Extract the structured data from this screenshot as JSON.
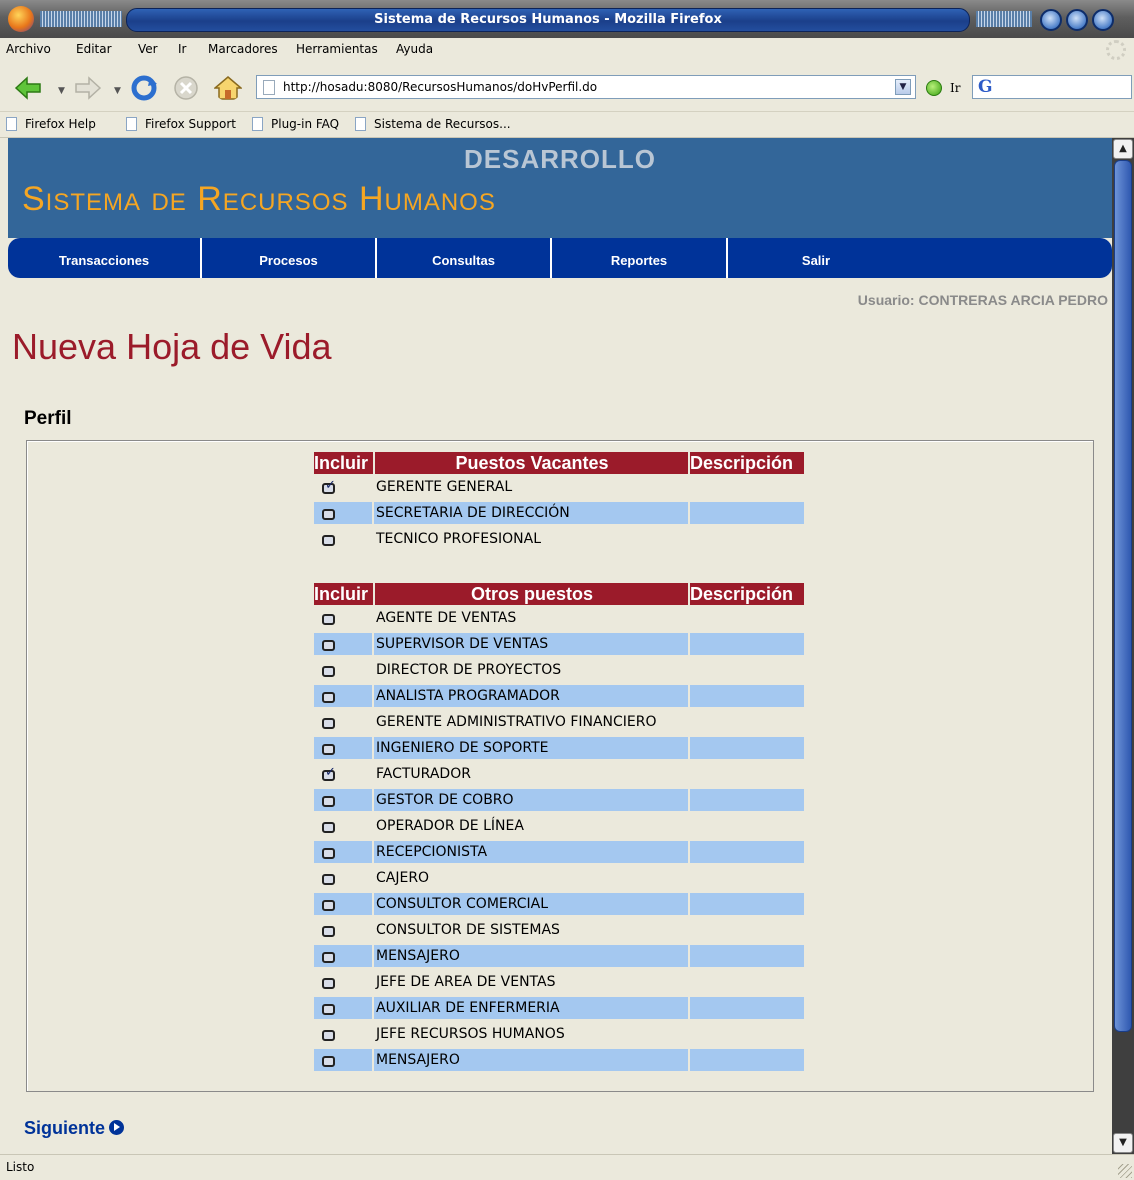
{
  "window": {
    "title": "Sistema de Recursos Humanos - Mozilla Firefox"
  },
  "menubar": [
    "Archivo",
    "Editar",
    "Ver",
    "Ir",
    "Marcadores",
    "Herramientas",
    "Ayuda"
  ],
  "navbar": {
    "url": "http://hosadu:8080/RecursosHumanos/doHvPerfil.do",
    "go_label": "Ir",
    "search_logo": "G"
  },
  "bookmarks": [
    "Firefox Help",
    "Firefox Support",
    "Plug-in FAQ",
    "Sistema de Recursos..."
  ],
  "header": {
    "environment": "DESARROLLO",
    "system": "Sistema de Recursos Humanos"
  },
  "nav_tabs": [
    "Transacciones",
    "Procesos",
    "Consultas",
    "Reportes",
    "Salir"
  ],
  "user": "Usuario: CONTRERAS ARCIA PEDRO",
  "page_title": "Nueva Hoja de Vida",
  "section_title": "Perfil",
  "vacantes": {
    "headers": [
      "Incluir",
      "Puestos Vacantes",
      "Descripción"
    ],
    "rows": [
      {
        "label": "GERENTE GENERAL",
        "checked": true
      },
      {
        "label": "SECRETARIA DE DIRECCIÓN",
        "checked": false
      },
      {
        "label": "TECNICO PROFESIONAL",
        "checked": false
      }
    ]
  },
  "otros": {
    "headers": [
      "Incluir",
      "Otros puestos",
      "Descripción"
    ],
    "rows": [
      {
        "label": "AGENTE DE VENTAS",
        "checked": false
      },
      {
        "label": "SUPERVISOR DE VENTAS",
        "checked": false
      },
      {
        "label": "DIRECTOR DE PROYECTOS",
        "checked": false
      },
      {
        "label": "ANALISTA PROGRAMADOR",
        "checked": false
      },
      {
        "label": "GERENTE ADMINISTRATIVO FINANCIERO",
        "checked": false
      },
      {
        "label": "INGENIERO DE SOPORTE",
        "checked": false
      },
      {
        "label": "FACTURADOR",
        "checked": true
      },
      {
        "label": "GESTOR DE COBRO",
        "checked": false
      },
      {
        "label": "OPERADOR DE LÍNEA",
        "checked": false
      },
      {
        "label": "RECEPCIONISTA",
        "checked": false
      },
      {
        "label": "CAJERO",
        "checked": false
      },
      {
        "label": "CONSULTOR COMERCIAL",
        "checked": false
      },
      {
        "label": "CONSULTOR DE SISTEMAS",
        "checked": false
      },
      {
        "label": "MENSAJERO",
        "checked": false
      },
      {
        "label": "JEFE DE AREA DE VENTAS",
        "checked": false
      },
      {
        "label": "AUXILIAR DE ENFERMERIA",
        "checked": false
      },
      {
        "label": "JEFE RECURSOS HUMANOS",
        "checked": false
      },
      {
        "label": "MENSAJERO",
        "checked": false
      }
    ]
  },
  "next_label": "Siguiente",
  "status": "Listo",
  "colors": {
    "header_bg": "#336699",
    "nav_bg": "#003399",
    "title_red": "#9b1b2a",
    "system_orange": "#f5a623",
    "row_alt": "#a4c8f0"
  }
}
